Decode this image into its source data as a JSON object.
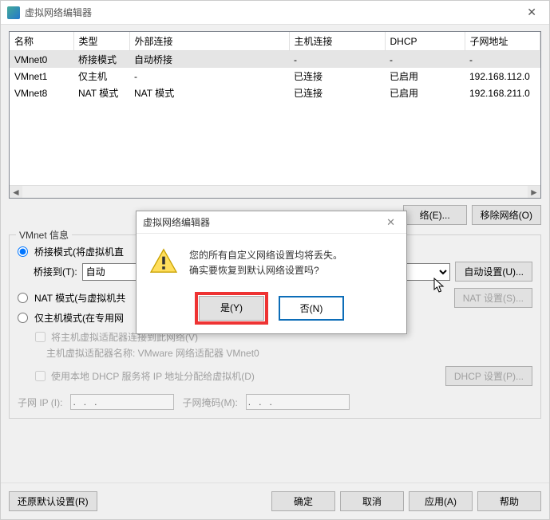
{
  "window": {
    "title": "虚拟网络编辑器",
    "close_glyph": "✕"
  },
  "table": {
    "headers": {
      "name": "名称",
      "type": "类型",
      "ext": "外部连接",
      "host": "主机连接",
      "dhcp": "DHCP",
      "subnet": "子网地址"
    },
    "rows": [
      {
        "name": "VMnet0",
        "type": "桥接模式",
        "ext": "自动桥接",
        "host": "-",
        "dhcp": "-",
        "subnet": "-",
        "selected": true
      },
      {
        "name": "VMnet1",
        "type": "仅主机",
        "ext": "-",
        "host": "已连接",
        "dhcp": "已启用",
        "subnet": "192.168.112.0",
        "selected": false
      },
      {
        "name": "VMnet8",
        "type": "NAT 模式",
        "ext": "NAT 模式",
        "host": "已连接",
        "dhcp": "已启用",
        "subnet": "192.168.211.0",
        "selected": false
      }
    ]
  },
  "net_buttons": {
    "add": "络(E)...",
    "remove": "移除网络(O)"
  },
  "vmnet": {
    "legend": "VMnet 信息",
    "bridged": "桥接模式(将虚拟机直",
    "bridged_to_label": "桥接到(T):",
    "bridged_to_value": "自动",
    "auto_settings": "自动设置(U)...",
    "nat": "NAT 模式(与虚拟机共",
    "nat_settings": "NAT 设置(S)...",
    "hostonly": "仅主机模式(在专用网",
    "connect_host": "将主机虚拟适配器连接到此网络(V)",
    "host_adapter_hint": "主机虚拟适配器名称: VMware 网络适配器 VMnet0",
    "use_dhcp": "使用本地 DHCP 服务将 IP 地址分配给虚拟机(D)",
    "dhcp_settings": "DHCP 设置(P)...",
    "subnet_ip_label": "子网 IP (I):",
    "subnet_ip_value": ".   .   .",
    "subnet_mask_label": "子网掩码(M):",
    "subnet_mask_value": ".   .   ."
  },
  "bottom": {
    "restore": "还原默认设置(R)",
    "ok": "确定",
    "cancel": "取消",
    "apply": "应用(A)",
    "help": "帮助"
  },
  "dialog": {
    "title": "虚拟网络编辑器",
    "line1": "您的所有自定义网络设置均将丢失。",
    "line2": "确实要恢复到默认网络设置吗?",
    "yes": "是(Y)",
    "no": "否(N)",
    "close_glyph": "✕"
  }
}
